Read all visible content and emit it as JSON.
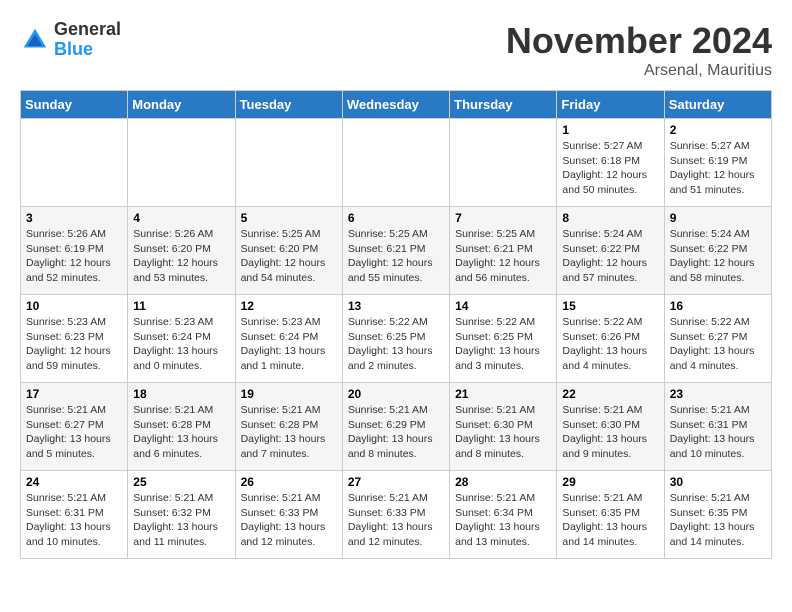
{
  "logo": {
    "general": "General",
    "blue": "Blue"
  },
  "title": "November 2024",
  "subtitle": "Arsenal, Mauritius",
  "days_of_week": [
    "Sunday",
    "Monday",
    "Tuesday",
    "Wednesday",
    "Thursday",
    "Friday",
    "Saturday"
  ],
  "weeks": [
    [
      {
        "num": "",
        "info": ""
      },
      {
        "num": "",
        "info": ""
      },
      {
        "num": "",
        "info": ""
      },
      {
        "num": "",
        "info": ""
      },
      {
        "num": "",
        "info": ""
      },
      {
        "num": "1",
        "info": "Sunrise: 5:27 AM\nSunset: 6:18 PM\nDaylight: 12 hours\nand 50 minutes."
      },
      {
        "num": "2",
        "info": "Sunrise: 5:27 AM\nSunset: 6:19 PM\nDaylight: 12 hours\nand 51 minutes."
      }
    ],
    [
      {
        "num": "3",
        "info": "Sunrise: 5:26 AM\nSunset: 6:19 PM\nDaylight: 12 hours\nand 52 minutes."
      },
      {
        "num": "4",
        "info": "Sunrise: 5:26 AM\nSunset: 6:20 PM\nDaylight: 12 hours\nand 53 minutes."
      },
      {
        "num": "5",
        "info": "Sunrise: 5:25 AM\nSunset: 6:20 PM\nDaylight: 12 hours\nand 54 minutes."
      },
      {
        "num": "6",
        "info": "Sunrise: 5:25 AM\nSunset: 6:21 PM\nDaylight: 12 hours\nand 55 minutes."
      },
      {
        "num": "7",
        "info": "Sunrise: 5:25 AM\nSunset: 6:21 PM\nDaylight: 12 hours\nand 56 minutes."
      },
      {
        "num": "8",
        "info": "Sunrise: 5:24 AM\nSunset: 6:22 PM\nDaylight: 12 hours\nand 57 minutes."
      },
      {
        "num": "9",
        "info": "Sunrise: 5:24 AM\nSunset: 6:22 PM\nDaylight: 12 hours\nand 58 minutes."
      }
    ],
    [
      {
        "num": "10",
        "info": "Sunrise: 5:23 AM\nSunset: 6:23 PM\nDaylight: 12 hours\nand 59 minutes."
      },
      {
        "num": "11",
        "info": "Sunrise: 5:23 AM\nSunset: 6:24 PM\nDaylight: 13 hours\nand 0 minutes."
      },
      {
        "num": "12",
        "info": "Sunrise: 5:23 AM\nSunset: 6:24 PM\nDaylight: 13 hours\nand 1 minute."
      },
      {
        "num": "13",
        "info": "Sunrise: 5:22 AM\nSunset: 6:25 PM\nDaylight: 13 hours\nand 2 minutes."
      },
      {
        "num": "14",
        "info": "Sunrise: 5:22 AM\nSunset: 6:25 PM\nDaylight: 13 hours\nand 3 minutes."
      },
      {
        "num": "15",
        "info": "Sunrise: 5:22 AM\nSunset: 6:26 PM\nDaylight: 13 hours\nand 4 minutes."
      },
      {
        "num": "16",
        "info": "Sunrise: 5:22 AM\nSunset: 6:27 PM\nDaylight: 13 hours\nand 4 minutes."
      }
    ],
    [
      {
        "num": "17",
        "info": "Sunrise: 5:21 AM\nSunset: 6:27 PM\nDaylight: 13 hours\nand 5 minutes."
      },
      {
        "num": "18",
        "info": "Sunrise: 5:21 AM\nSunset: 6:28 PM\nDaylight: 13 hours\nand 6 minutes."
      },
      {
        "num": "19",
        "info": "Sunrise: 5:21 AM\nSunset: 6:28 PM\nDaylight: 13 hours\nand 7 minutes."
      },
      {
        "num": "20",
        "info": "Sunrise: 5:21 AM\nSunset: 6:29 PM\nDaylight: 13 hours\nand 8 minutes."
      },
      {
        "num": "21",
        "info": "Sunrise: 5:21 AM\nSunset: 6:30 PM\nDaylight: 13 hours\nand 8 minutes."
      },
      {
        "num": "22",
        "info": "Sunrise: 5:21 AM\nSunset: 6:30 PM\nDaylight: 13 hours\nand 9 minutes."
      },
      {
        "num": "23",
        "info": "Sunrise: 5:21 AM\nSunset: 6:31 PM\nDaylight: 13 hours\nand 10 minutes."
      }
    ],
    [
      {
        "num": "24",
        "info": "Sunrise: 5:21 AM\nSunset: 6:31 PM\nDaylight: 13 hours\nand 10 minutes."
      },
      {
        "num": "25",
        "info": "Sunrise: 5:21 AM\nSunset: 6:32 PM\nDaylight: 13 hours\nand 11 minutes."
      },
      {
        "num": "26",
        "info": "Sunrise: 5:21 AM\nSunset: 6:33 PM\nDaylight: 13 hours\nand 12 minutes."
      },
      {
        "num": "27",
        "info": "Sunrise: 5:21 AM\nSunset: 6:33 PM\nDaylight: 13 hours\nand 12 minutes."
      },
      {
        "num": "28",
        "info": "Sunrise: 5:21 AM\nSunset: 6:34 PM\nDaylight: 13 hours\nand 13 minutes."
      },
      {
        "num": "29",
        "info": "Sunrise: 5:21 AM\nSunset: 6:35 PM\nDaylight: 13 hours\nand 14 minutes."
      },
      {
        "num": "30",
        "info": "Sunrise: 5:21 AM\nSunset: 6:35 PM\nDaylight: 13 hours\nand 14 minutes."
      }
    ]
  ]
}
